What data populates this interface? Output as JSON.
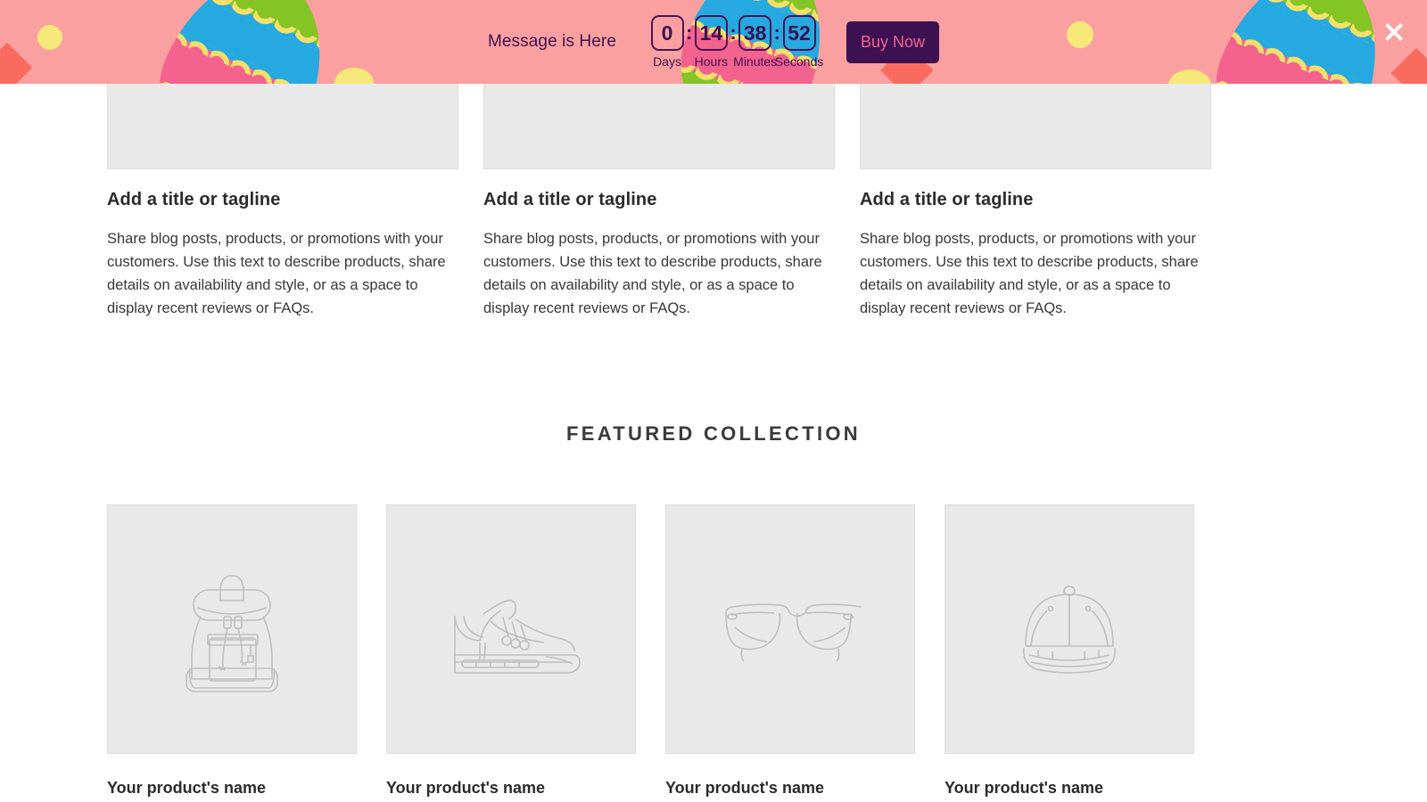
{
  "banner": {
    "message": "Message is Here",
    "close_icon": "close-icon",
    "background_color": "#FBA0A0",
    "text_color": "#3D1152",
    "countdown": [
      {
        "value": "0",
        "label": "Days"
      },
      {
        "value": "14",
        "label": "Hours"
      },
      {
        "value": "38",
        "label": "Minutes"
      },
      {
        "value": "52",
        "label": "Seconds"
      }
    ],
    "separator": ":",
    "cta": {
      "label": "Buy Now",
      "background_color": "#3D1152",
      "text_color": "#F4628E"
    },
    "decorations": {
      "egg_stripe_green": "#84C424",
      "egg_stripe_blue": "#25A9E0",
      "egg_stripe_pink": "#F4628E",
      "egg_wave_yellow": "#F2E06B",
      "dot_yellow": "#F7E87A",
      "heart_coral": "#F96B5F"
    }
  },
  "text_columns": [
    {
      "image_placeholder": "image-placeholder",
      "title": "Add a title or tagline",
      "body": "Share blog posts, products, or promotions with your customers. Use this text to describe products, share details on availability and style, or as a space to display recent reviews or FAQs."
    },
    {
      "image_placeholder": "image-placeholder",
      "title": "Add a title or tagline",
      "body": "Share blog posts, products, or promotions with your customers. Use this text to describe products, share details on availability and style, or as a space to display recent reviews or FAQs."
    },
    {
      "image_placeholder": "image-placeholder",
      "title": "Add a title or tagline",
      "body": "Share blog posts, products, or promotions with your customers. Use this text to describe products, share details on availability and style, or as a space to display recent reviews or FAQs."
    }
  ],
  "featured": {
    "heading": "FEATURED COLLECTION",
    "products": [
      {
        "name": "Your product's name",
        "icon": "backpack-icon"
      },
      {
        "name": "Your product's name",
        "icon": "sneaker-icon"
      },
      {
        "name": "Your product's name",
        "icon": "eyeglasses-icon"
      },
      {
        "name": "Your product's name",
        "icon": "baseball-cap-icon"
      }
    ]
  }
}
